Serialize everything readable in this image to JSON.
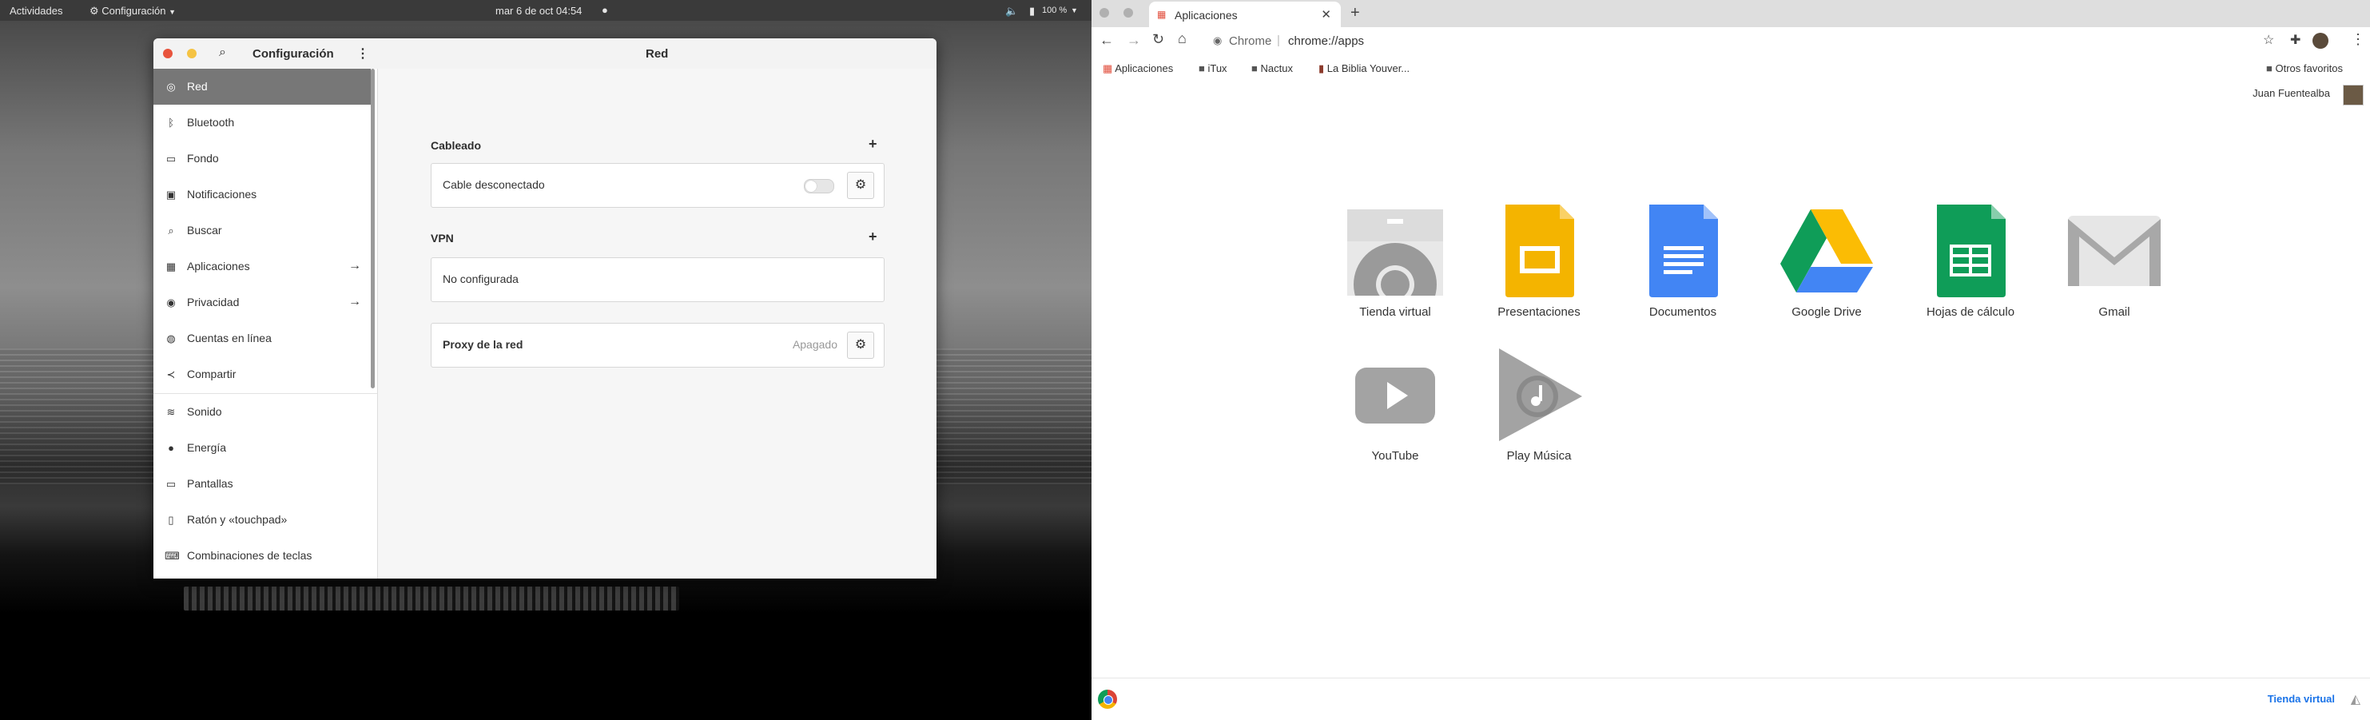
{
  "gnome": {
    "topbar": {
      "activities": "Actividades",
      "app_menu": "Configuración",
      "clock": "mar  6 de oct  04:54",
      "volume_percent": "100 %"
    },
    "settings_window": {
      "sidebar_title": "Configuración",
      "panel_title": "Red",
      "sidebar_items": [
        {
          "label": "Red",
          "icon": "network-icon",
          "selected": true
        },
        {
          "label": "Bluetooth",
          "icon": "bluetooth-icon"
        },
        {
          "label": "Fondo",
          "icon": "background-icon"
        },
        {
          "label": "Notificaciones",
          "icon": "notifications-icon"
        },
        {
          "label": "Buscar",
          "icon": "search-icon"
        },
        {
          "label": "Aplicaciones",
          "icon": "apps-icon",
          "arrow": true
        },
        {
          "label": "Privacidad",
          "icon": "privacy-icon",
          "arrow": true
        },
        {
          "label": "Cuentas en línea",
          "icon": "online-accounts-icon"
        },
        {
          "label": "Compartir",
          "icon": "share-icon"
        },
        {
          "label": "Sonido",
          "icon": "sound-icon"
        },
        {
          "label": "Energía",
          "icon": "power-icon"
        },
        {
          "label": "Pantallas",
          "icon": "displays-icon"
        },
        {
          "label": "Ratón y «touchpad»",
          "icon": "mouse-icon"
        },
        {
          "label": "Combinaciones de teclas",
          "icon": "keyboard-icon"
        }
      ],
      "sections": {
        "wired": {
          "title": "Cableado",
          "row_label": "Cable desconectado",
          "toggle_on": false
        },
        "vpn": {
          "title": "VPN",
          "row_label": "No configurada"
        },
        "proxy": {
          "title": "Proxy de la red",
          "status": "Apagado"
        }
      }
    }
  },
  "chrome": {
    "tab": {
      "title": "Aplicaciones"
    },
    "omnibox": {
      "site_label": "Chrome",
      "url": "chrome://apps"
    },
    "bookmarks": [
      {
        "label": "Aplicaciones",
        "icon": "apps-grid-icon"
      },
      {
        "label": "iTux",
        "icon": "folder-icon"
      },
      {
        "label": "Nactux",
        "icon": "folder-icon"
      },
      {
        "label": "La Biblia Youver...",
        "icon": "bible-icon"
      }
    ],
    "other_bookmarks": "Otros favoritos",
    "profile_name": "Juan Fuentealba",
    "apps": [
      {
        "label": "Tienda virtual",
        "icon": "web-store-icon"
      },
      {
        "label": "Presentaciones",
        "icon": "slides-icon"
      },
      {
        "label": "Documentos",
        "icon": "docs-icon"
      },
      {
        "label": "Google Drive",
        "icon": "drive-icon"
      },
      {
        "label": "Hojas de cálculo",
        "icon": "sheets-icon"
      },
      {
        "label": "Gmail",
        "icon": "gmail-icon"
      },
      {
        "label": "YouTube",
        "icon": "youtube-icon"
      },
      {
        "label": "Play Música",
        "icon": "play-music-icon"
      }
    ],
    "footer_link": "Tienda virtual",
    "colors": {
      "accent_blue": "#1a73e8",
      "slides": "#f4b400",
      "docs": "#4285f4",
      "sheets": "#0f9d58"
    }
  }
}
